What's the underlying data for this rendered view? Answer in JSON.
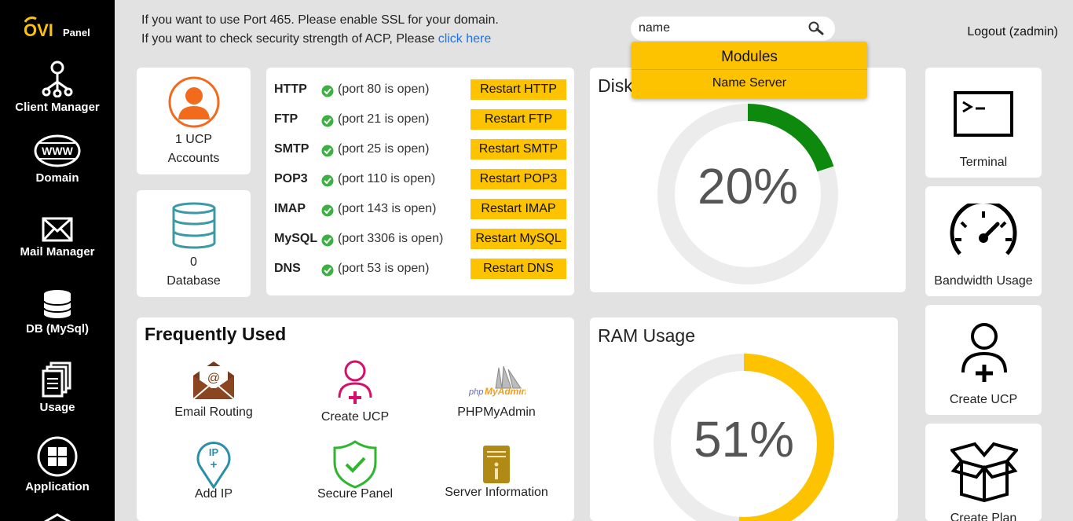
{
  "brand": {
    "logo_ovi": "OVI",
    "logo_panel": "Panel"
  },
  "sidebar": {
    "items": [
      {
        "label": "Client Manager",
        "icon": "client-manager-icon"
      },
      {
        "label": "Domain",
        "icon": "www-icon"
      },
      {
        "label": "Mail Manager",
        "icon": "mail-icon"
      },
      {
        "label": "DB (MySql)",
        "icon": "database-icon"
      },
      {
        "label": "Usage",
        "icon": "usage-icon"
      },
      {
        "label": "Application",
        "icon": "application-icon"
      }
    ]
  },
  "notice": {
    "line1": "If you want to use Port 465. Please enable SSL for your domain.",
    "line2_prefix": "If you want to check security strength of ACP, Please",
    "line2_link": "click here"
  },
  "search": {
    "value": "name",
    "icon": "search-icon"
  },
  "search_dropdown": {
    "header": "Modules",
    "items": [
      "Name Server"
    ]
  },
  "logout": {
    "label": "Logout (zadmin)"
  },
  "stats": {
    "ucp": {
      "count": "1 UCP",
      "label": "Accounts"
    },
    "database": {
      "count": "0",
      "label": "Database"
    }
  },
  "services": [
    {
      "name": "HTTP",
      "status": "(port 80 is open)",
      "button": "Restart HTTP"
    },
    {
      "name": "FTP",
      "status": "(port 21 is open)",
      "button": "Restart FTP"
    },
    {
      "name": "SMTP",
      "status": "(port 25 is open)",
      "button": "Restart SMTP"
    },
    {
      "name": "POP3",
      "status": "(port 110 is open)",
      "button": "Restart POP3"
    },
    {
      "name": "IMAP",
      "status": "(port 143 is open)",
      "button": "Restart IMAP"
    },
    {
      "name": "MySQL",
      "status": "(port 3306 is open)",
      "button": "Restart MySQL"
    },
    {
      "name": "DNS",
      "status": "(port 53 is open)",
      "button": "Restart DNS"
    }
  ],
  "disk": {
    "title": "Disk",
    "value_text": "20%",
    "value": 20,
    "color": "#0d8a0d",
    "track": "#ececec"
  },
  "ram": {
    "title": "RAM Usage",
    "value_text": "51%",
    "value": 51,
    "color": "#fdc300",
    "track": "#ececec"
  },
  "frequently_used": {
    "title": "Frequently Used",
    "items": [
      {
        "label": "Email Routing",
        "icon": "email-routing-icon"
      },
      {
        "label": "Create UCP",
        "icon": "create-ucp-icon"
      },
      {
        "label": "PHPMyAdmin",
        "icon": "phpmyadmin-icon"
      },
      {
        "label": "Add IP",
        "icon": "add-ip-icon"
      },
      {
        "label": "Secure Panel",
        "icon": "secure-panel-icon"
      },
      {
        "label": "Server Information",
        "icon": "server-info-icon"
      }
    ]
  },
  "right_tiles": [
    {
      "label": "Terminal",
      "icon": "terminal-icon"
    },
    {
      "label": "Bandwidth Usage",
      "icon": "speedometer-icon"
    },
    {
      "label": "Create UCP",
      "icon": "add-user-icon"
    },
    {
      "label": "Create Plan",
      "icon": "box-icon"
    }
  ],
  "colors": {
    "accent": "#fdc300",
    "link": "#1a73e8",
    "sidebar": "#000000",
    "check": "#3cb043"
  }
}
